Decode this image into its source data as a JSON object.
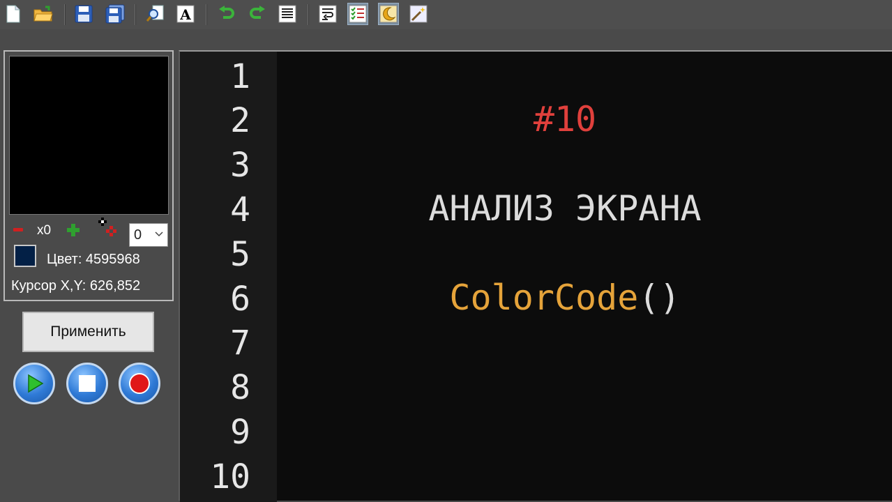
{
  "toolbar": {
    "buttons": [
      {
        "name": "new-file-icon"
      },
      {
        "name": "open-folder-icon"
      },
      {
        "name": "save-icon"
      },
      {
        "name": "save-all-icon"
      },
      {
        "name": "find-icon"
      },
      {
        "name": "font-icon"
      },
      {
        "name": "undo-icon"
      },
      {
        "name": "redo-icon"
      },
      {
        "name": "align-text-icon"
      },
      {
        "name": "word-wrap-icon"
      },
      {
        "name": "checklist-icon"
      },
      {
        "name": "night-mode-icon"
      },
      {
        "name": "magic-wand-icon"
      }
    ]
  },
  "panel": {
    "zoom_label": "x0",
    "zoom_select_value": "0",
    "color_label": "Цвет: 4595968",
    "swatch_color": "#032046",
    "cursor_label": "Курсор X,Y: 626,852",
    "apply_label": "Применить",
    "controls": [
      "play-icon",
      "stop-icon",
      "record-icon"
    ]
  },
  "editor": {
    "line_numbers": [
      "1",
      "2",
      "3",
      "4",
      "5",
      "6",
      "7",
      "8",
      "9",
      "10"
    ],
    "lines": [
      {
        "line": 2,
        "text": "#10",
        "color": "#e0403c"
      },
      {
        "line": 4,
        "text": "АНАЛИЗ ЭКРАНА",
        "color": "#dcdcdc"
      },
      {
        "line": 6,
        "segments": [
          {
            "text": "ColorCode",
            "color": "#e5a33a"
          },
          {
            "text": "()",
            "color": "#dcdcdc"
          }
        ]
      }
    ]
  },
  "colors": {
    "editor_bg": "#0c0c0c",
    "gutter_bg": "#1a1a1a",
    "chrome_bg": "#4a4a4a"
  }
}
